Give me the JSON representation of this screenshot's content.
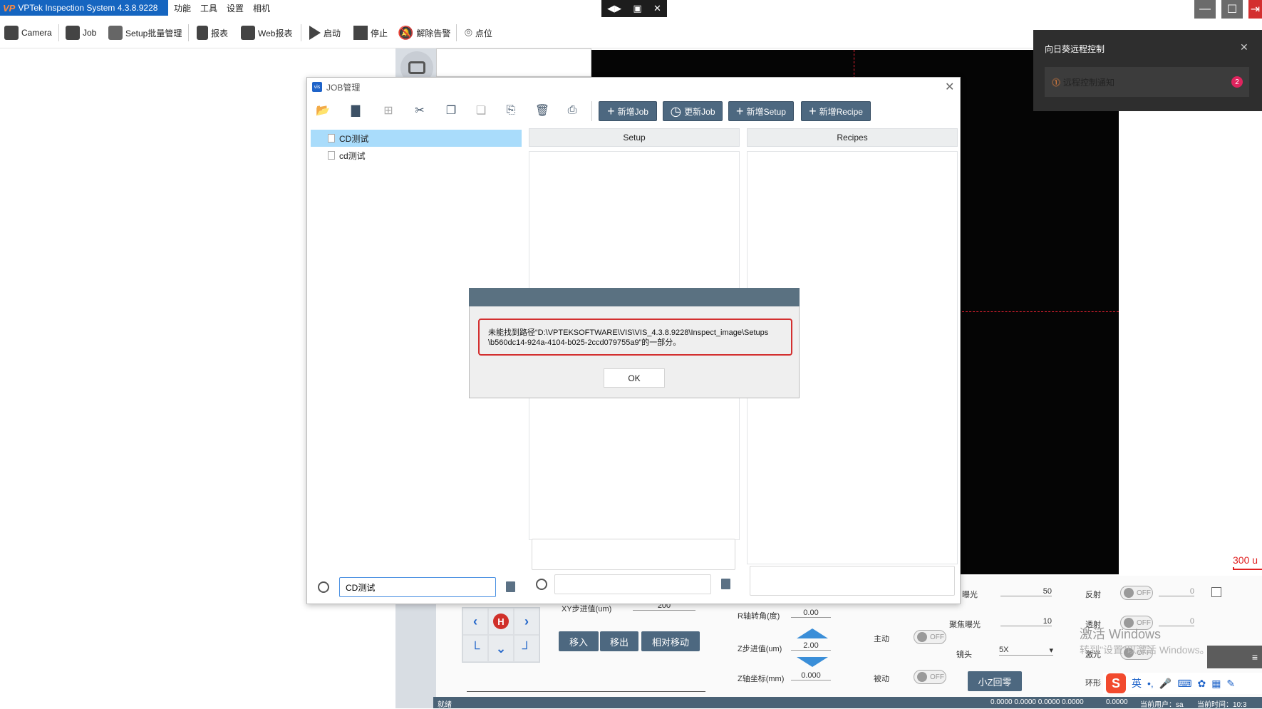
{
  "titlebar": {
    "app_title": "VPTek Inspection System 4.3.8.9228",
    "logo": "VP",
    "menus": [
      "功能",
      "工具",
      "设置",
      "相机"
    ],
    "remote_icons": [
      "◀▶",
      "▣",
      "✕"
    ],
    "window_buttons": [
      "—",
      "☐",
      "⇥"
    ]
  },
  "toolbar": {
    "items": [
      "Camera",
      "Job",
      "Setup批量管理",
      "报表",
      "Web报表",
      "启动",
      "停止",
      "解除告警",
      "点位"
    ]
  },
  "remote_panel": {
    "title": "向日葵远程控制",
    "close": "✕",
    "item_label": "远程控制通知",
    "item_badge": "2"
  },
  "job_dialog": {
    "title": "JOB管理",
    "logo": "vis",
    "close": "✕",
    "buttons": {
      "new_job": "新增Job",
      "update_job": "更新Job",
      "new_setup": "新增Setup",
      "new_recipe": "新增Recipe"
    },
    "tree": [
      "CD测试",
      "cd测试"
    ],
    "columns": {
      "setup": "Setup",
      "recipes": "Recipes"
    },
    "search_value": "CD测试"
  },
  "error_modal": {
    "message_line1": "未能找到路径“D:\\VPTEKSOFTWARE\\VIS\\VIS_4.3.8.9228\\Inspect_image\\Setups",
    "message_line2": "\\b560dc14-924a-4104-b025-2ccd079755a9”的一部分。",
    "ok": "OK"
  },
  "scale_text": "300 u",
  "bottom": {
    "xy_step_label": "XY步进值(um)",
    "xy_step_value": "200",
    "r_axis_label": "R轴转角(度)",
    "r_axis_value": "0.00",
    "z_step_label": "Z步进值(um)",
    "z_step_value": "2.00",
    "z_coord_label": "Z轴坐标(mm)",
    "z_coord_value": "0.000",
    "move_in": "移入",
    "move_out": "移出",
    "relative_move": "相对移动",
    "pad_home": "H",
    "active": "主动",
    "passive": "被动",
    "toggle_off": "OFF",
    "exposure_label": "曝光",
    "exposure_value": "50",
    "focus_exposure_label": "聚焦曝光",
    "focus_exposure_value": "10",
    "lens_label": "镜头",
    "lens_value": "5X",
    "small_z_home": "小Z回零",
    "reflect": "反射",
    "transmit": "透射",
    "laser": "激光",
    "ring": "环形",
    "reflect_value": "0",
    "transmit_value": "0",
    "status": "就绪",
    "coords": "0.0000 0.0000 0.0000 0.0000",
    "coords2": "0.0000",
    "current_user": "当前用户：sa",
    "current_time": "当前时间：10:3"
  },
  "watermark": {
    "line1": "激活 Windows",
    "line2": "转到\"设置\"以激活 Windows。"
  },
  "ime": {
    "logo": "S",
    "lang": "英"
  }
}
